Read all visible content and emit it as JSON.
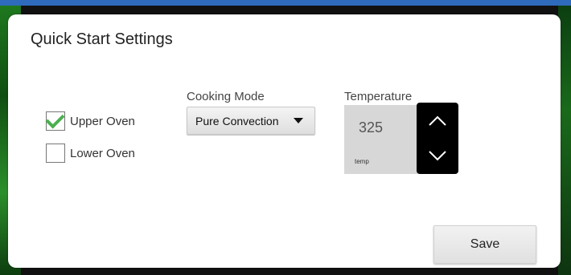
{
  "dialog": {
    "title": "Quick Start Settings"
  },
  "ovens": [
    {
      "label": "Upper Oven",
      "checked": true
    },
    {
      "label": "Lower Oven",
      "checked": false
    }
  ],
  "cooking_mode": {
    "label": "Cooking Mode",
    "selected": "Pure Convection"
  },
  "temperature": {
    "label": "Temperature",
    "value": "325",
    "unit_label": "temp"
  },
  "actions": {
    "save_label": "Save"
  },
  "icons": {
    "check": "check-icon",
    "dropdown": "caret-down-icon",
    "increase": "chevron-up-icon",
    "decrease": "chevron-down-icon"
  },
  "colors": {
    "check": "#4caf50",
    "stepper": "#000000"
  }
}
